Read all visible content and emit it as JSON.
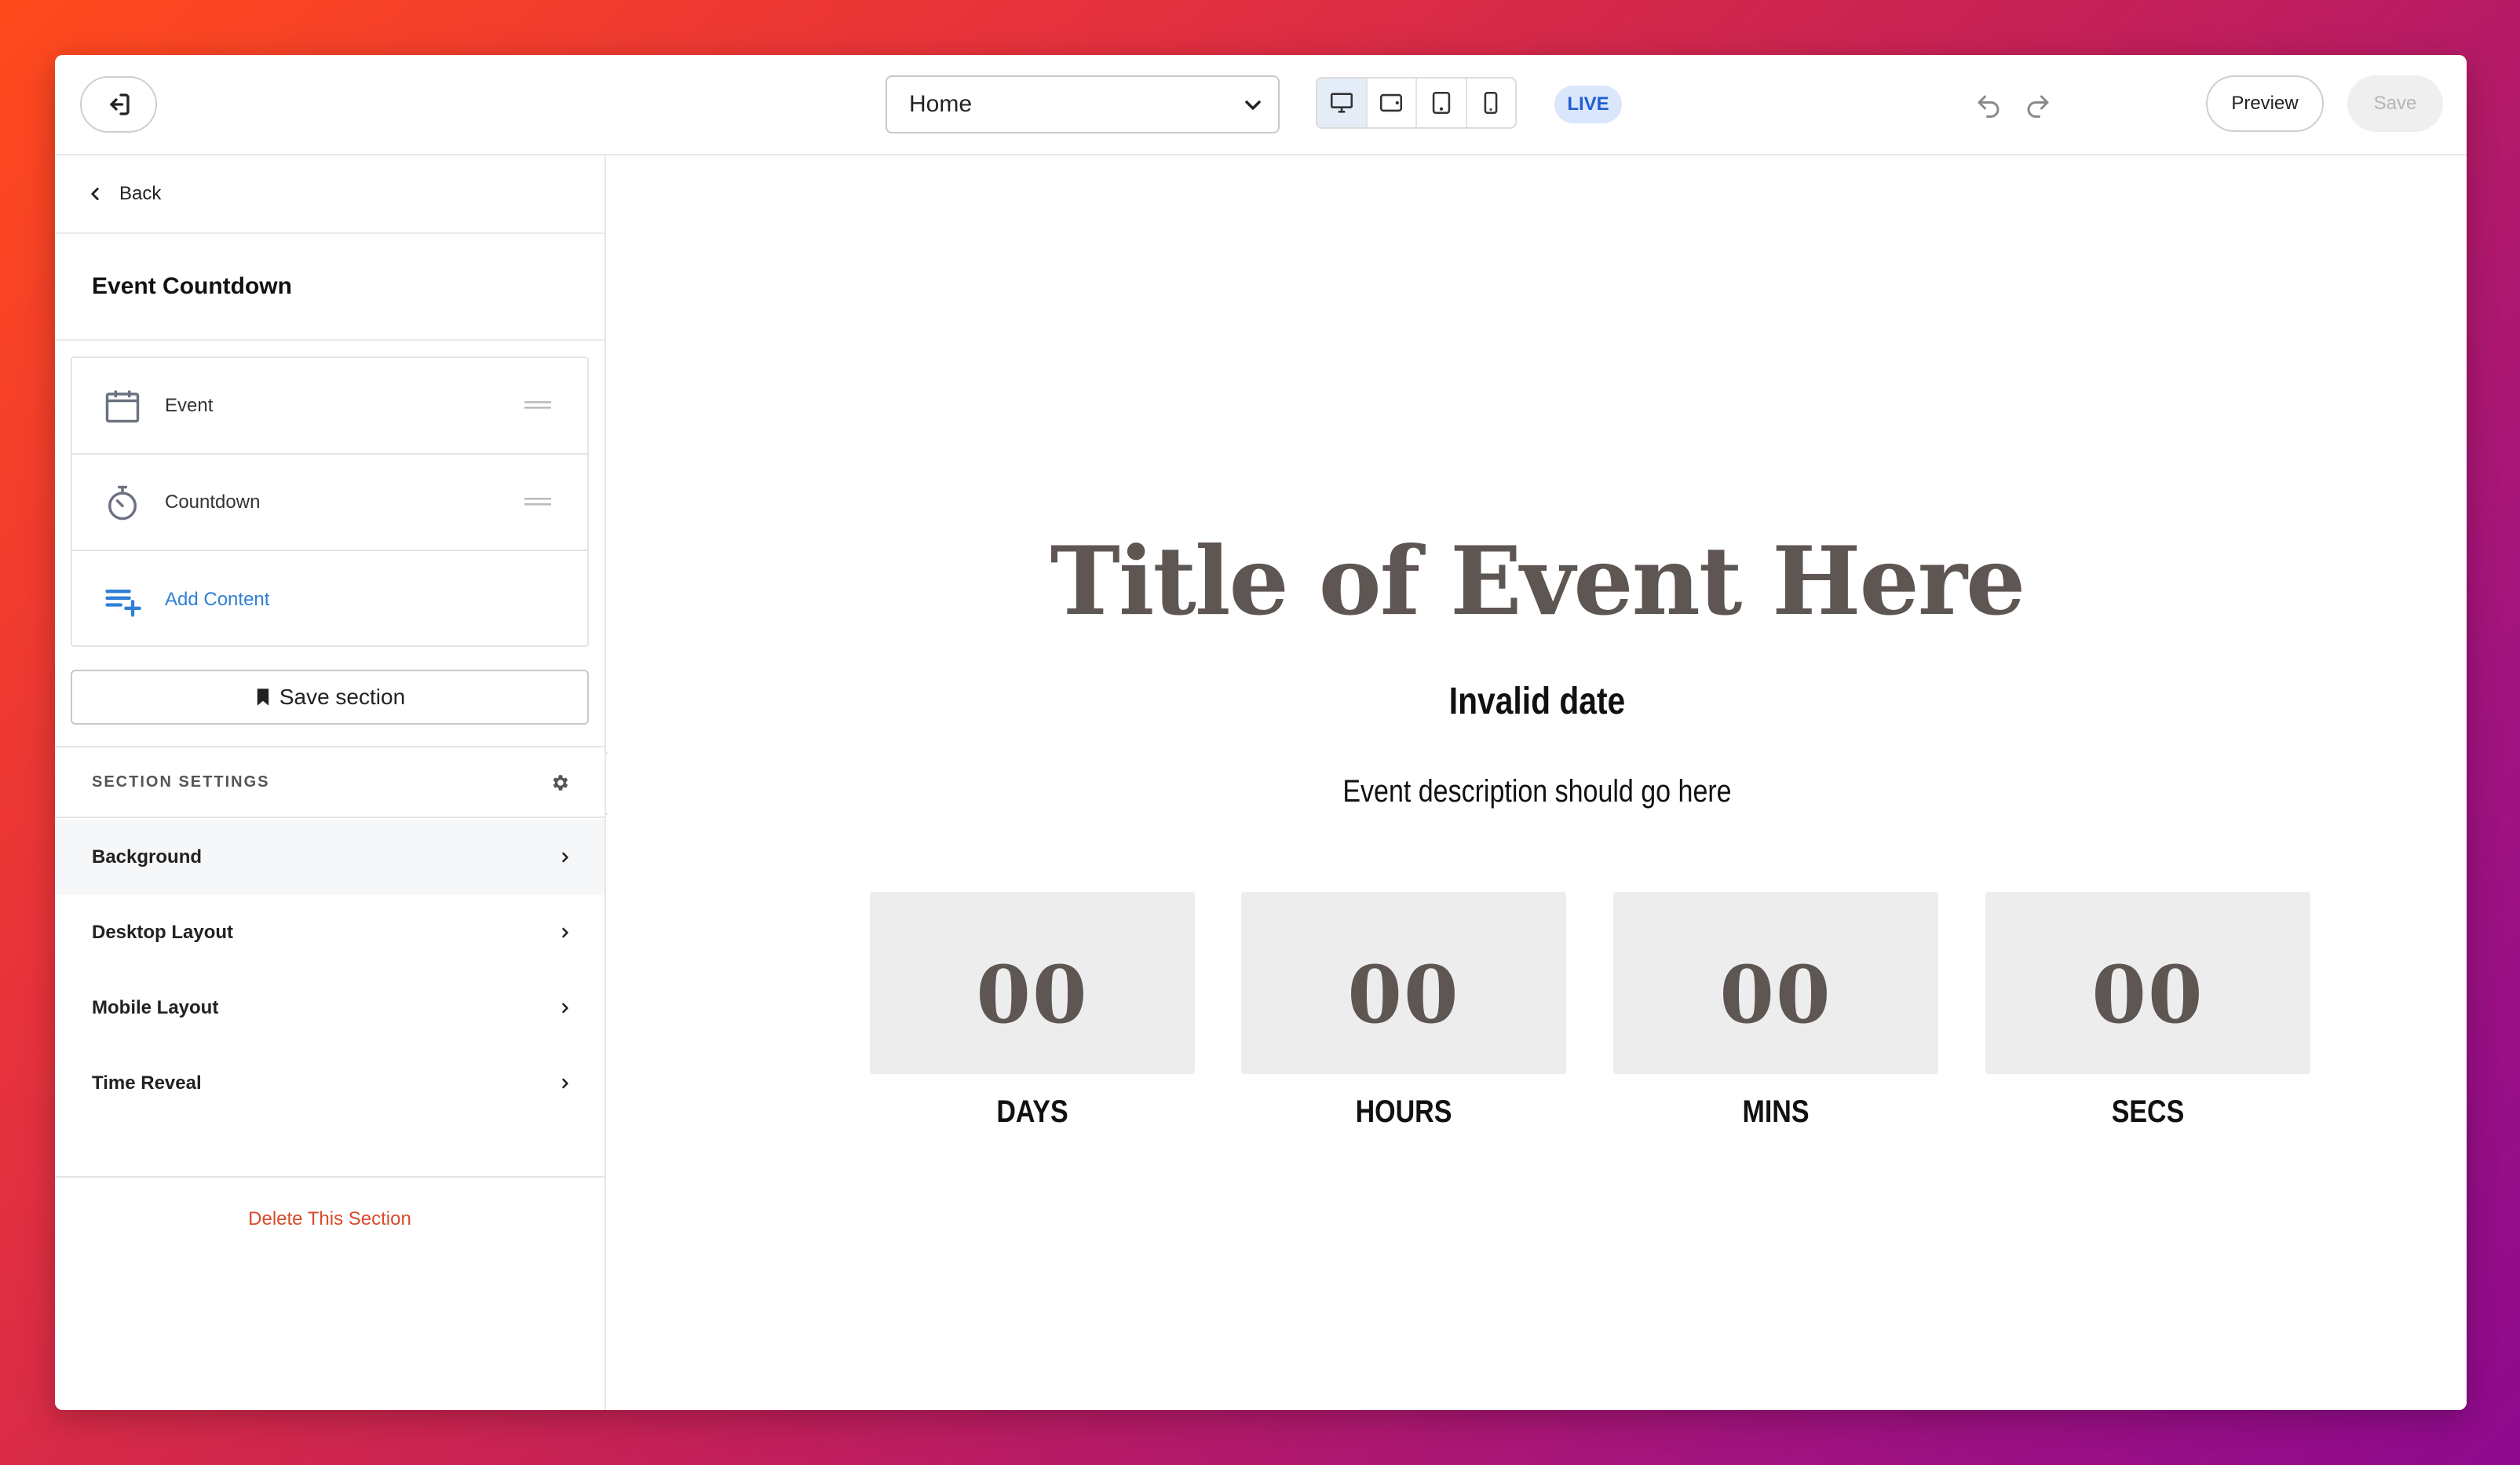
{
  "topbar": {
    "page_select_value": "Home",
    "live_label": "LIVE",
    "preview_label": "Preview",
    "save_label": "Save"
  },
  "sidebar": {
    "back_label": "Back",
    "section_title": "Event Countdown",
    "content_items": [
      {
        "label": "Event",
        "icon": "calendar-icon"
      },
      {
        "label": "Countdown",
        "icon": "stopwatch-icon"
      },
      {
        "label": "Add Content",
        "icon": "playlist-add-icon"
      }
    ],
    "save_section_label": "Save section",
    "settings_header": "SECTION SETTINGS",
    "settings": [
      {
        "label": "Background"
      },
      {
        "label": "Desktop Layout"
      },
      {
        "label": "Mobile Layout"
      },
      {
        "label": "Time Reveal"
      }
    ],
    "delete_label": "Delete This Section"
  },
  "canvas": {
    "title": "Title of Event Here",
    "date": "Invalid date",
    "description": "Event description should go here",
    "countdown": [
      {
        "value": "00",
        "label": "DAYS"
      },
      {
        "value": "00",
        "label": "HOURS"
      },
      {
        "value": "00",
        "label": "MINS"
      },
      {
        "value": "00",
        "label": "SECS"
      }
    ]
  },
  "colors": {
    "accent_blue": "#2f80d6",
    "live_bg": "#d9e6fb",
    "delete_red": "#d94a2b",
    "title_color": "#5e5653",
    "countdown_box": "#ededed"
  }
}
